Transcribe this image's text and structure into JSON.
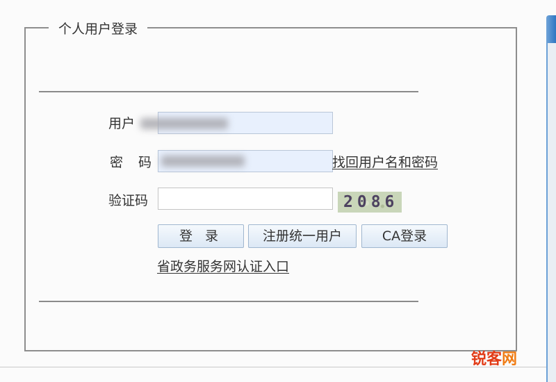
{
  "panel": {
    "legend": "个人用户登录"
  },
  "form": {
    "username_label": "用户",
    "password_label": "密码",
    "captcha_label": "验证码",
    "username_value": "",
    "password_value": "",
    "captcha_value": "",
    "captcha_text": "2086",
    "find_link": "找回用户名和密码"
  },
  "buttons": {
    "login": "登 录",
    "register": "注册统一用户",
    "ca": "CA登录"
  },
  "links": {
    "gov_portal": "省政务服务网认证入口"
  },
  "watermark": {
    "part1": "锐客",
    "part2": "网"
  },
  "colors": {
    "input_bg": "#e8f0fd",
    "captcha_text": "#4d4260",
    "watermark_red": "#e23b16",
    "watermark_orange": "#f07c14"
  }
}
